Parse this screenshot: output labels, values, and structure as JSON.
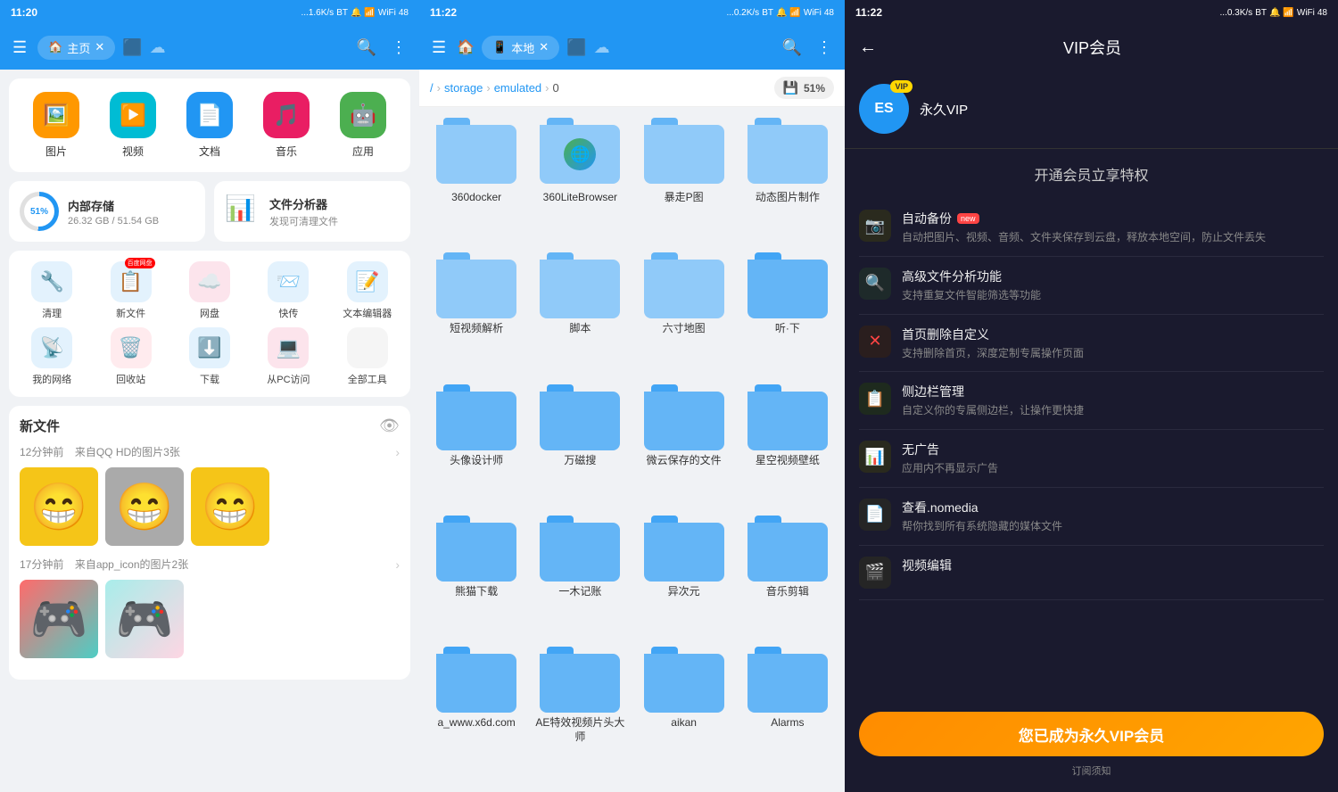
{
  "panel1": {
    "status": {
      "time": "11:20",
      "signal": "...1.6K/s",
      "battery": "48"
    },
    "nav": {
      "menu_icon": "☰",
      "home_tab": "主页",
      "close_icon": "✕",
      "search_icon": "🔍",
      "more_icon": "⋮"
    },
    "categories": [
      {
        "id": "images",
        "label": "图片",
        "icon": "🖼️",
        "color": "#FF9800"
      },
      {
        "id": "video",
        "label": "视频",
        "icon": "▶",
        "color": "#00BCD4"
      },
      {
        "id": "docs",
        "label": "文档",
        "icon": "📄",
        "color": "#2196F3"
      },
      {
        "id": "music",
        "label": "音乐",
        "icon": "🎵",
        "color": "#E91E63"
      },
      {
        "id": "apps",
        "label": "应用",
        "icon": "🤖",
        "color": "#4CAF50"
      }
    ],
    "storage": {
      "internal_title": "内部存储",
      "internal_used": "26.32 GB / 51.54 GB",
      "internal_percent": "51%",
      "analyzer_title": "文件分析器",
      "analyzer_sub": "发现可清理文件"
    },
    "tools": [
      {
        "id": "clean",
        "label": "清理",
        "icon": "🔧",
        "color": "#e8f4ff"
      },
      {
        "id": "newfile",
        "label": "新文件",
        "icon": "📋",
        "color": "#e8f4ff",
        "badge": "百度网盘"
      },
      {
        "id": "cloud",
        "label": "网盘",
        "icon": "☁️",
        "color": "#e8f4ff"
      },
      {
        "id": "transfer",
        "label": "快传",
        "icon": "📨",
        "color": "#e8f4ff"
      },
      {
        "id": "editor",
        "label": "文本编辑器",
        "icon": "📝",
        "color": "#e8f4ff"
      },
      {
        "id": "network",
        "label": "我的网络",
        "icon": "📡",
        "color": "#e8f4ff"
      },
      {
        "id": "trash",
        "label": "回收站",
        "icon": "🗑️",
        "color": "#e8f4ff"
      },
      {
        "id": "download",
        "label": "下载",
        "icon": "⬇️",
        "color": "#e8f4ff"
      },
      {
        "id": "pc",
        "label": "从PC访问",
        "icon": "💻",
        "color": "#e8f4ff"
      },
      {
        "id": "all",
        "label": "全部工具",
        "icon": "⬛",
        "color": "#e8f4ff"
      }
    ],
    "new_files": {
      "title": "新文件",
      "groups": [
        {
          "time": "12分钟前",
          "source": "来自QQ HD的图片3张",
          "thumbs": [
            "😁",
            "😁",
            "😁"
          ]
        },
        {
          "time": "17分钟前",
          "source": "来自app_icon的图片2张",
          "thumbs": [
            "🎮",
            "🎮"
          ]
        }
      ]
    }
  },
  "panel2": {
    "status": {
      "time": "11:22",
      "signal": "...0.2K/s",
      "battery": "48"
    },
    "nav": {
      "menu_icon": "☰",
      "local_tab": "本地",
      "close_icon": "✕",
      "search_icon": "🔍",
      "more_icon": "⋮"
    },
    "breadcrumb": {
      "root": "/",
      "path1": "storage",
      "path2": "emulated",
      "path3": "0"
    },
    "storage_percent": "51%",
    "folders": [
      {
        "name": "360docker"
      },
      {
        "name": "360LiteBrowser"
      },
      {
        "name": "暴走P图"
      },
      {
        "name": "动态图片制作"
      },
      {
        "name": "短视频解析"
      },
      {
        "name": "脚本"
      },
      {
        "name": "六寸地图"
      },
      {
        "name": "听·下"
      },
      {
        "name": "头像设计师"
      },
      {
        "name": "万磁搜"
      },
      {
        "name": "微云保存的文件"
      },
      {
        "name": "星空视频壁纸"
      },
      {
        "name": "熊猫下载"
      },
      {
        "name": "一木记账"
      },
      {
        "name": "异次元"
      },
      {
        "name": "音乐剪辑"
      },
      {
        "name": "a_www.x6d.com"
      },
      {
        "name": "AE特效视频片头大师"
      },
      {
        "name": "aikan"
      },
      {
        "name": "Alarms"
      }
    ],
    "special_folder": {
      "name": "360LiteBrowser",
      "has_app_icon": true
    }
  },
  "panel3": {
    "status": {
      "time": "11:22",
      "signal": "...0.3K/s",
      "battery": "48"
    },
    "nav": {
      "back_icon": "←",
      "title": "VIP会员"
    },
    "user": {
      "avatar_icon": "🔤",
      "vip_badge": "VIP",
      "name": "永久VIP"
    },
    "benefits_title": "开通会员立享特权",
    "benefits": [
      {
        "id": "backup",
        "title": "自动备份",
        "is_new": true,
        "desc": "自动把图片、视频、音频、文件夹保存到云盘，释放本地空间，防止文件丢失",
        "icon": "📷",
        "icon_color": "#FF9800"
      },
      {
        "id": "analyzer",
        "title": "高级文件分析功能",
        "is_new": false,
        "desc": "支持重复文件智能筛选等功能",
        "icon": "🔍",
        "icon_color": "#FF9800"
      },
      {
        "id": "homepage",
        "title": "首页删除自定义",
        "is_new": false,
        "desc": "支持删除首页，深度定制专属操作页面",
        "icon": "✕",
        "icon_color": "#FF4444"
      },
      {
        "id": "sidebar",
        "title": "侧边栏管理",
        "is_new": false,
        "desc": "自定义你的专属侧边栏，让操作更快捷",
        "icon": "📋",
        "icon_color": "#FF9800"
      },
      {
        "id": "noad",
        "title": "无广告",
        "is_new": false,
        "desc": "应用内不再显示广告",
        "icon": "📊",
        "icon_color": "#FF9800"
      },
      {
        "id": "nomedia",
        "title": "查看.nomedia",
        "is_new": false,
        "desc": "帮你找到所有系统隐藏的媒体文件",
        "icon": "📄",
        "icon_color": "#888"
      },
      {
        "id": "videoeditor",
        "title": "视频编辑",
        "is_new": false,
        "desc": "",
        "icon": "🎬",
        "icon_color": "#888"
      }
    ],
    "cta_button": "您已成为永久VIP会员",
    "subscribe_note": "订阅须知"
  }
}
